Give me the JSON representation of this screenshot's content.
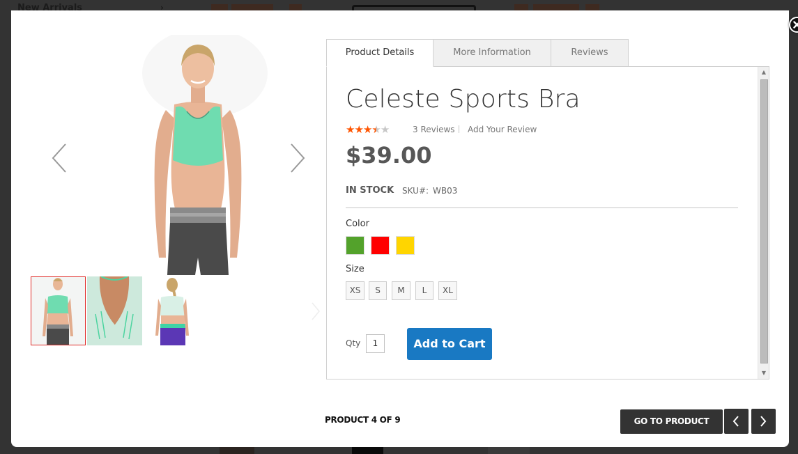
{
  "background": {
    "nav_label": "New Arrivals"
  },
  "modal": {
    "close_label": "✕"
  },
  "gallery": {
    "main_image_alt": "Celeste Sports Bra - front view",
    "thumbnails": [
      {
        "alt": "Front view",
        "active": true
      },
      {
        "alt": "Back detail",
        "active": false
      },
      {
        "alt": "Back view",
        "active": false
      }
    ]
  },
  "tabs": [
    {
      "label": "Product Details",
      "active": true
    },
    {
      "label": "More Information",
      "active": false
    },
    {
      "label": "Reviews",
      "active": false
    }
  ],
  "product": {
    "name": "Celeste Sports Bra",
    "rating": {
      "value": 3.5,
      "max": 5
    },
    "reviews_link": "3 Reviews",
    "add_review_link": "Add Your Review",
    "price": "$39.00",
    "stock_status": "IN STOCK",
    "sku_label": "SKU#:",
    "sku_value": "WB03",
    "color_label": "Color",
    "colors": [
      {
        "name": "Green",
        "hex": "#53a22b"
      },
      {
        "name": "Red",
        "hex": "#ff0000"
      },
      {
        "name": "Yellow",
        "hex": "#ffd500"
      }
    ],
    "size_label": "Size",
    "sizes": [
      "XS",
      "S",
      "M",
      "L",
      "XL"
    ],
    "qty_label": "Qty",
    "qty_value": "1",
    "add_to_cart_label": "Add to Cart",
    "accent_color": "#1979c3"
  },
  "footer": {
    "counter": "PRODUCT 4 OF 9",
    "go_to_product_label": "GO TO PRODUCT"
  }
}
